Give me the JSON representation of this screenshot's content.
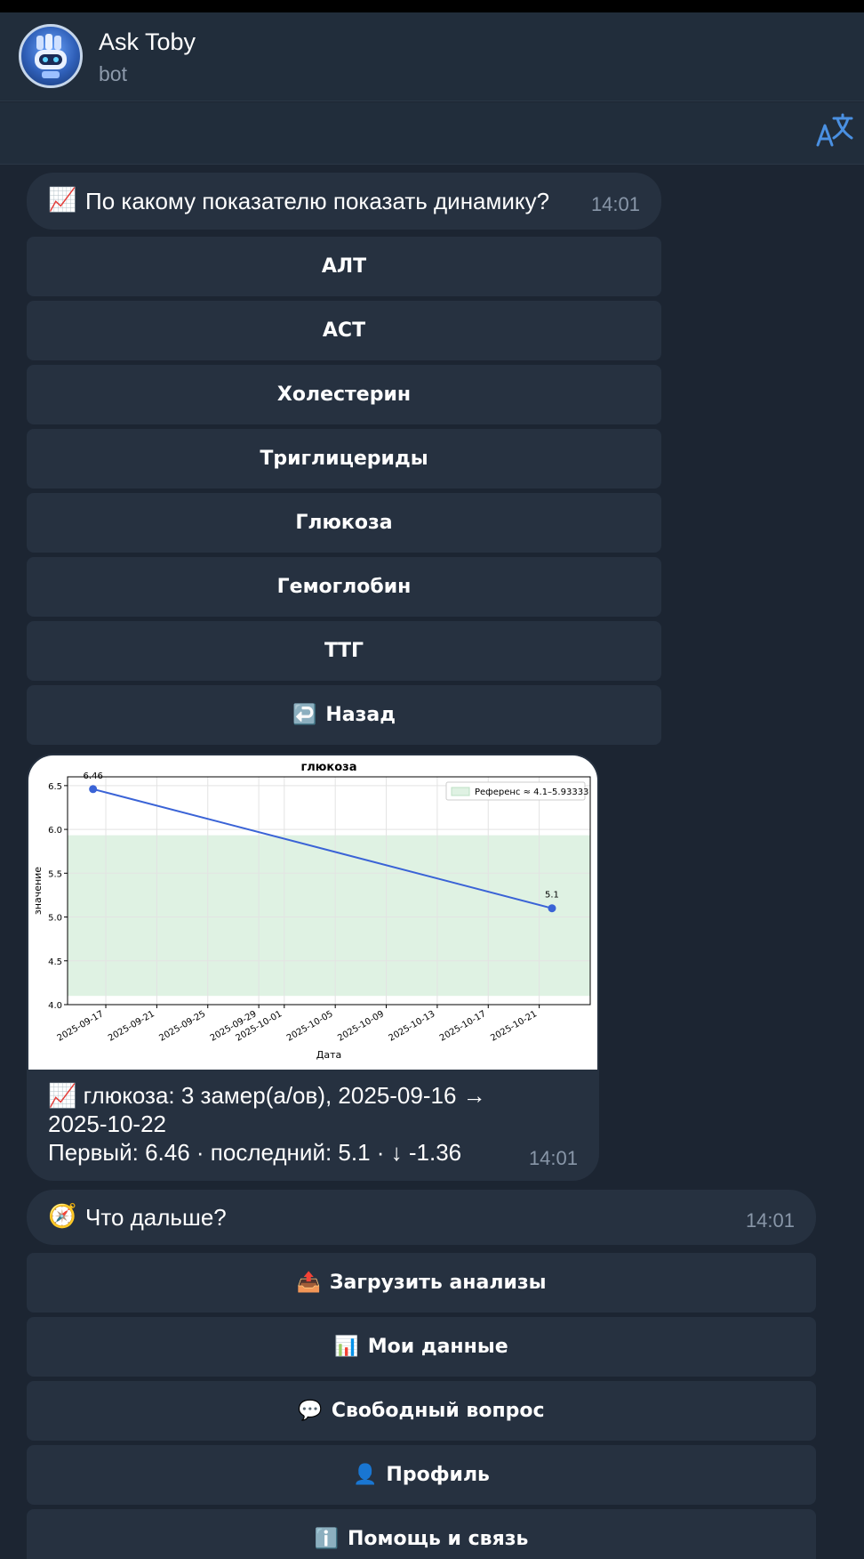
{
  "header": {
    "title": "Ask Toby",
    "subtitle": "bot"
  },
  "message1": {
    "emoji": "📈",
    "text": "По какому показателю показать динамику?",
    "time": "14:01"
  },
  "keyboard1": [
    {
      "label": "АЛТ"
    },
    {
      "label": "АСТ"
    },
    {
      "label": "Холестерин"
    },
    {
      "label": "Триглицериды"
    },
    {
      "label": "Глюкоза"
    },
    {
      "label": "Гемоглобин"
    },
    {
      "label": "ТТГ"
    },
    {
      "emoji": "↩️",
      "label": "Назад"
    }
  ],
  "chart_data": {
    "type": "line",
    "title": "глюкоза",
    "xlabel": "Дата",
    "ylabel": "значение",
    "x": [
      "2025-09-16",
      "2025-10-22"
    ],
    "series": [
      {
        "values": [
          6.46,
          5.1
        ]
      }
    ],
    "point_labels": [
      "6.46",
      "5.1"
    ],
    "reference_band": {
      "label": "Референс ≈ 4.1–5.93333",
      "low": 4.1,
      "high": 5.93333,
      "color": "#dff2e3"
    },
    "ylim": [
      4.0,
      6.6
    ],
    "yticks": [
      "4.0",
      "4.5",
      "5.0",
      "5.5",
      "6.0",
      "6.5"
    ],
    "xticks": [
      "2025-09-17",
      "2025-09-21",
      "2025-09-25",
      "2025-09-29",
      "2025-10-01",
      "2025-10-05",
      "2025-10-09",
      "2025-10-13",
      "2025-10-17",
      "2025-10-21"
    ],
    "line_color": "#3a63d6",
    "grid": true,
    "legend": "top-right"
  },
  "photo_caption": {
    "emoji": "📈",
    "line1": "глюкоза: 3 замер(а/ов), 2025-09-16 →",
    "line2": "2025-10-22",
    "line3": "Первый: 6.46 · последний: 5.1 · ↓ -1.36",
    "time": "14:01"
  },
  "message2": {
    "emoji": "🧭",
    "text": "Что дальше?",
    "time": "14:01"
  },
  "keyboard2": [
    {
      "emoji": "📤",
      "label": "Загрузить анализы"
    },
    {
      "emoji": "📊",
      "label": "Мои данные"
    },
    {
      "emoji": "💬",
      "label": "Свободный вопрос"
    },
    {
      "emoji": "👤",
      "label": "Профиль"
    },
    {
      "emoji": "ℹ️",
      "label": "Помощь и связь"
    }
  ],
  "colors": {
    "background": "#1c2532",
    "bubble": "#263140",
    "accent": "#4a90e2"
  }
}
